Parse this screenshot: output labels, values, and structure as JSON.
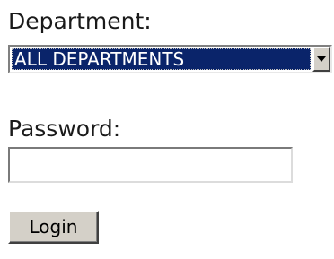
{
  "form": {
    "department_label": "Department:",
    "department_selected": "ALL DEPARTMENTS",
    "password_label": "Password:",
    "password_value": "",
    "login_label": "Login"
  },
  "icons": {
    "dropdown_arrow": "chevron-down-icon"
  },
  "colors": {
    "selection_background": "#0a246a",
    "selection_text": "#ffffff",
    "button_face": "#d4d0c8"
  }
}
